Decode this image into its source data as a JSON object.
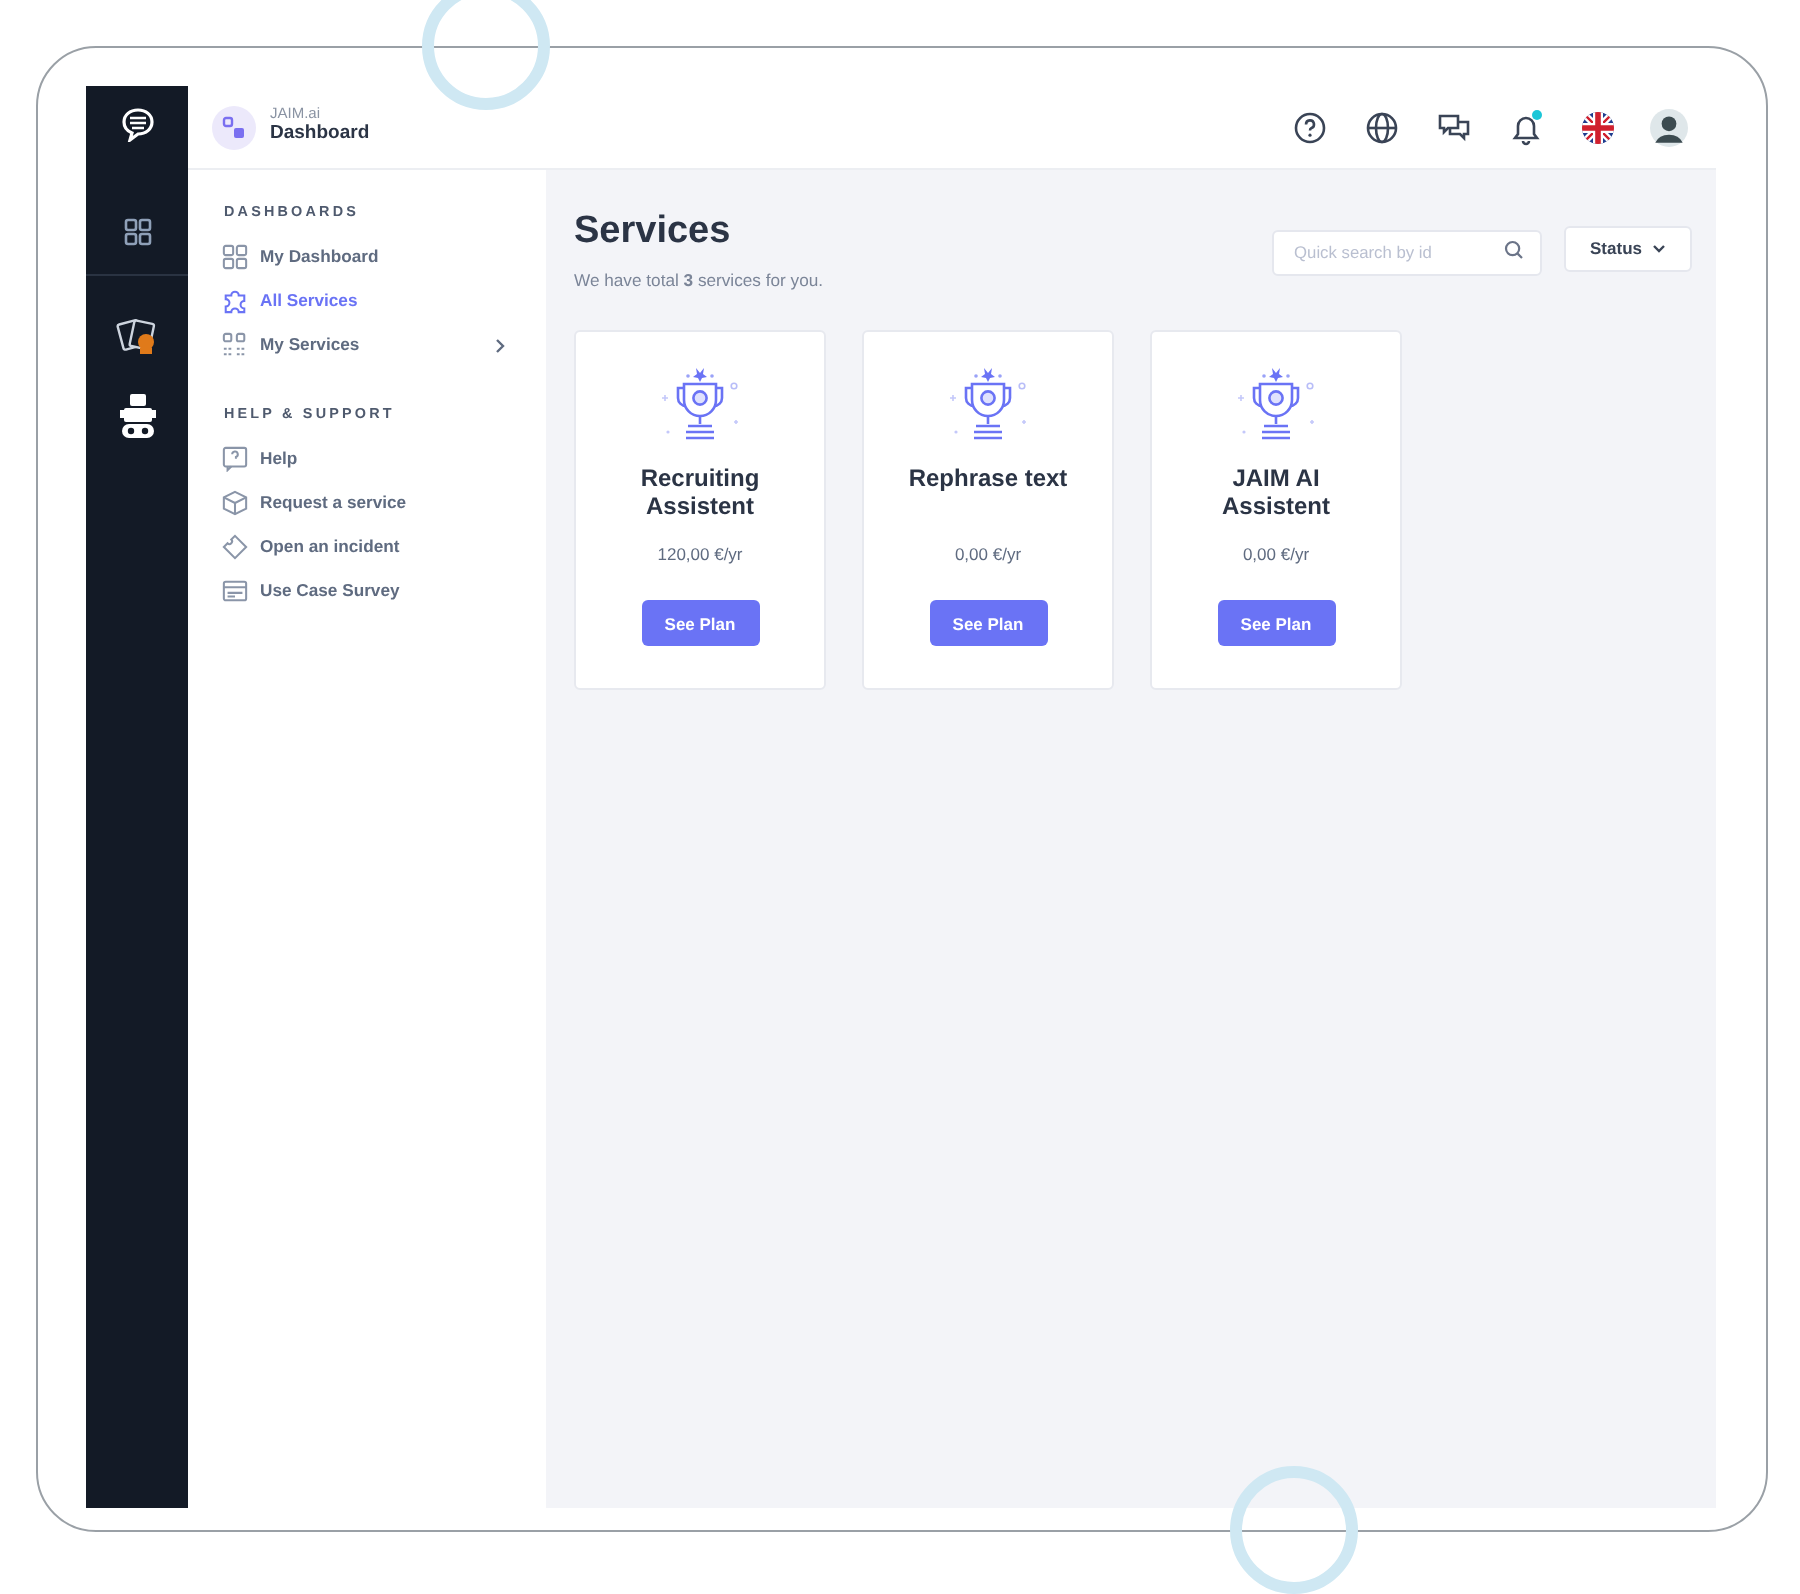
{
  "brand": {
    "name": "JAIM.ai",
    "page": "Dashboard"
  },
  "header_icons": [
    {
      "kind": "help"
    },
    {
      "kind": "globe"
    },
    {
      "kind": "chat"
    },
    {
      "kind": "bell",
      "notification": true
    },
    {
      "kind": "flag"
    },
    {
      "kind": "avatar"
    }
  ],
  "sidebar": {
    "sections": [
      {
        "title": "DASHBOARDS",
        "items": [
          {
            "label": "My Dashboard",
            "selected": false,
            "submenu": false
          },
          {
            "label": "All Services",
            "selected": true,
            "submenu": false
          },
          {
            "label": "My Services",
            "selected": false,
            "submenu": true
          }
        ]
      },
      {
        "title": "HELP & SUPPORT",
        "items": [
          {
            "label": "Help",
            "selected": false,
            "submenu": false
          },
          {
            "label": "Request a service",
            "selected": false,
            "submenu": false
          },
          {
            "label": "Open an incident",
            "selected": false,
            "submenu": false
          },
          {
            "label": "Use Case Survey",
            "selected": false,
            "submenu": false
          }
        ]
      }
    ]
  },
  "main": {
    "title": "Services",
    "subtitle": "We have total **3** services for you.",
    "search": {
      "placeholder": "Quick search by id"
    },
    "filter": "Status"
  },
  "services": [
    {
      "title": "Recruiting Assistent",
      "price": "120,00 €/yr",
      "button": "See Plan"
    },
    {
      "title": "Rephrase text",
      "price": "0,00 €/yr",
      "button": "See Plan"
    },
    {
      "title": "JAIM AI Assistent",
      "price": "0,00 €/yr",
      "button": "See Plan"
    }
  ]
}
